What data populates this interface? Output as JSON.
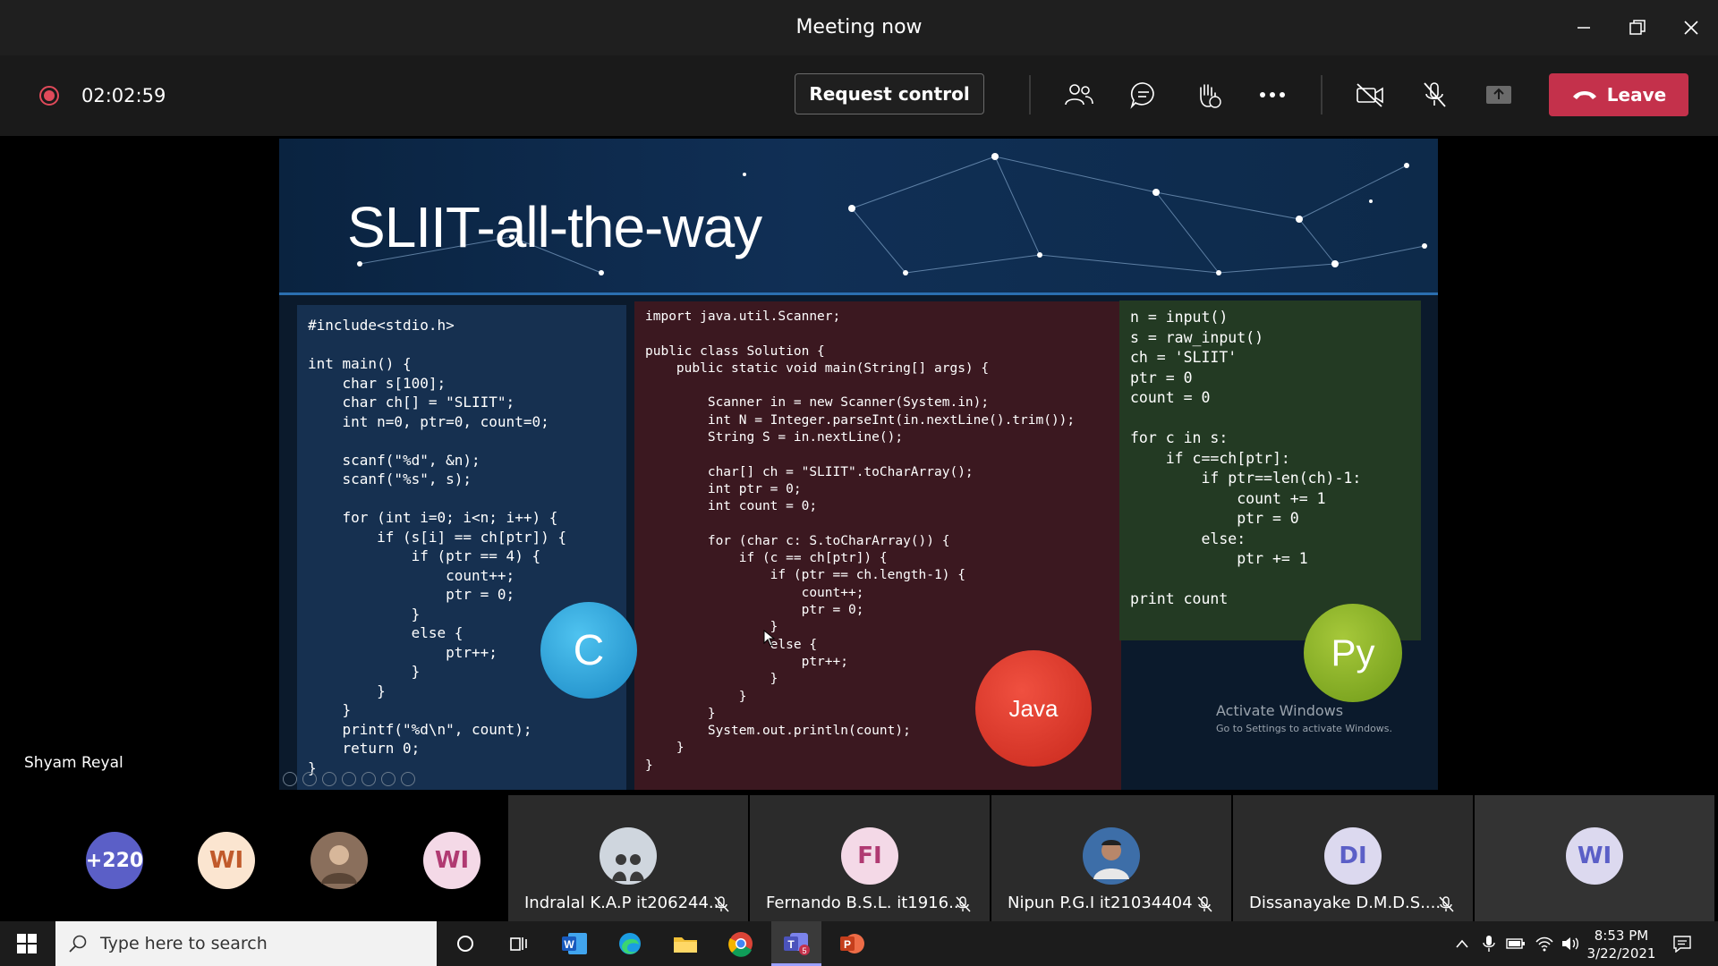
{
  "window": {
    "title": "Meeting now"
  },
  "toolbar": {
    "timer": "02:02:59",
    "request_control_label": "Request control",
    "leave_label": "Leave"
  },
  "presenter": {
    "name": "Shyam Reyal"
  },
  "slide": {
    "title": "SLIIT-all-the-way",
    "c_code": "#include<stdio.h>\n\nint main() {\n    char s[100];\n    char ch[] = \"SLIIT\";\n    int n=0, ptr=0, count=0;\n\n    scanf(\"%d\", &n);\n    scanf(\"%s\", s);\n\n    for (int i=0; i<n; i++) {\n        if (s[i] == ch[ptr]) {\n            if (ptr == 4) {\n                count++;\n                ptr = 0;\n            }\n            else {\n                ptr++;\n            }\n        }\n    }\n    printf(\"%d\\n\", count);\n    return 0;\n}",
    "java_code": "import java.util.Scanner;\n\npublic class Solution {\n    public static void main(String[] args) {\n\n        Scanner in = new Scanner(System.in);\n        int N = Integer.parseInt(in.nextLine().trim());\n        String S = in.nextLine();\n\n        char[] ch = \"SLIIT\".toCharArray();\n        int ptr = 0;\n        int count = 0;\n\n        for (char c: S.toCharArray()) {\n            if (c == ch[ptr]) {\n                if (ptr == ch.length-1) {\n                    count++;\n                    ptr = 0;\n                }\n                else {\n                    ptr++;\n                }\n            }\n        }\n        System.out.println(count);\n    }\n}",
    "python_code": "n = input()\ns = raw_input()\nch = 'SLIIT'\nptr = 0\ncount = 0\n\nfor c in s:\n    if c==ch[ptr]:\n        if ptr==len(ch)-1:\n            count += 1\n            ptr = 0\n        else:\n            ptr += 1\n\nprint count",
    "badge_c": "C",
    "badge_java": "Java",
    "badge_py": "Py",
    "watermark_title": "Activate Windows",
    "watermark_sub": "Go to Settings to activate Windows."
  },
  "participants": {
    "overflow": {
      "label": "+220",
      "color": "#5b5fc7"
    },
    "avatars": [
      {
        "initials": "WI",
        "bg": "#fbe5d0",
        "fg": "#c15a2b"
      },
      {
        "initials": "",
        "bg": "#8a6f5c",
        "fg": "#fff",
        "icon": "person-photo-icon"
      },
      {
        "initials": "WI",
        "bg": "#f4d9e7",
        "fg": "#b03a72"
      }
    ],
    "tiles": [
      {
        "name": "Indralal K.A.P it206244...",
        "initials": "",
        "bg": "#cfd6de",
        "fg": "#333",
        "icon": "person-photo-icon",
        "muted": true
      },
      {
        "name": "Fernando B.S.L. it1916...",
        "initials": "FI",
        "bg": "#f4d9e7",
        "fg": "#b03a72",
        "muted": true
      },
      {
        "name": "Nipun P.G.I it21034404",
        "initials": "",
        "bg": "#3d6ea8",
        "fg": "#fff",
        "icon": "person-photo-icon",
        "muted": true
      },
      {
        "name": "Dissanayake D.M.D.S....",
        "initials": "DI",
        "bg": "#dcd9ef",
        "fg": "#5b5fc7",
        "muted": true
      },
      {
        "name": "",
        "initials": "WI",
        "bg": "#dcd9ef",
        "fg": "#5b5fc7",
        "muted": false
      }
    ]
  },
  "taskbar": {
    "search_placeholder": "Type here to search",
    "time": "8:53 PM",
    "date": "3/22/2021",
    "apps": [
      "cortana-icon",
      "task-view-icon",
      "word-icon",
      "edge-icon",
      "file-explorer-icon",
      "chrome-icon",
      "teams-icon",
      "powerpoint-icon"
    ]
  },
  "colors": {
    "leave": "#c4314b",
    "record": "#e04a5a",
    "accent": "#5b5fc7"
  }
}
